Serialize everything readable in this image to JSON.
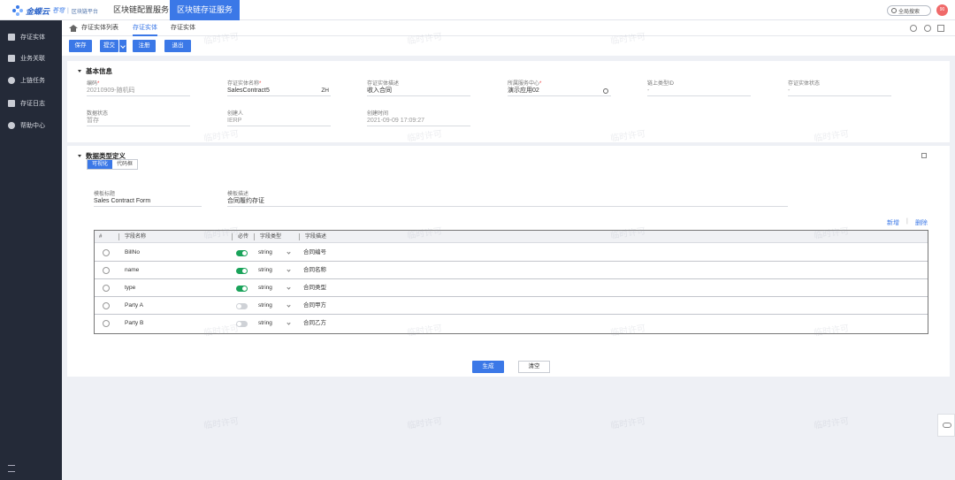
{
  "topbar": {
    "brand": "金蝶云",
    "brand_sub": "苍穹",
    "sep": "|",
    "platform": "区块链平台",
    "nav": [
      "区块链配置服务",
      "区块链存证服务"
    ],
    "search": "全局搜索",
    "avatar": "90"
  },
  "sidebar": {
    "items": [
      {
        "label": "存证实体",
        "icon": "grid-icon"
      },
      {
        "label": "业务关联",
        "icon": "puzzle-icon"
      },
      {
        "label": "上链任务",
        "icon": "user-icon"
      },
      {
        "label": "存证日志",
        "icon": "doc-icon"
      },
      {
        "label": "帮助中心",
        "icon": "help-icon"
      }
    ]
  },
  "tabs": [
    "存证实体列表",
    "存证实体",
    "存证实体"
  ],
  "toolbar": {
    "save": "保存",
    "submit": "提交",
    "register": "注册",
    "exit": "退出"
  },
  "basic": {
    "title": "基本信息",
    "fields": [
      {
        "label": "编码",
        "required": "*",
        "value": "20210909-随机码"
      },
      {
        "label": "存证实体名称",
        "required": "*",
        "value": "SalesContract5",
        "suffix": "ZH"
      },
      {
        "label": "存证实体描述",
        "required": "",
        "value": "收入合同"
      },
      {
        "label": "所属服务中心",
        "required": "*",
        "value": "演示应用02"
      },
      {
        "label": "链上类型ID",
        "required": "",
        "value": "-"
      },
      {
        "label": "存证实体状态",
        "required": "",
        "value": "-"
      },
      {
        "label": "数据状态",
        "required": "",
        "value": "暂存"
      },
      {
        "label": "创建人",
        "required": "",
        "value": "IERP"
      },
      {
        "label": "创建时间",
        "required": "",
        "value": "2021-09-09 17:09:27"
      }
    ]
  },
  "datatype": {
    "title": "数据类型定义",
    "seg": [
      "可视化",
      "代码框"
    ],
    "template_label": "模板标题",
    "template_value": "Sales Contract Form",
    "desc_label": "模板描述",
    "desc_value": "合同履约存证",
    "add": "新增",
    "delete": "删除",
    "divider": "|",
    "headers": [
      "#",
      "字段名称",
      "必传",
      "字段类型",
      "字段描述"
    ],
    "rows": [
      {
        "name": "BillNo",
        "required": true,
        "type": "string",
        "desc": "合同编号"
      },
      {
        "name": "name",
        "required": true,
        "type": "string",
        "desc": "合同名称"
      },
      {
        "name": "type",
        "required": true,
        "type": "string",
        "desc": "合同类型"
      },
      {
        "name": "Party A",
        "required": false,
        "type": "string",
        "desc": "合同甲方"
      },
      {
        "name": "Party B",
        "required": false,
        "type": "string",
        "desc": "合同乙方"
      }
    ],
    "generate": "生成",
    "clear": "清空"
  },
  "watermark": "临时许可"
}
